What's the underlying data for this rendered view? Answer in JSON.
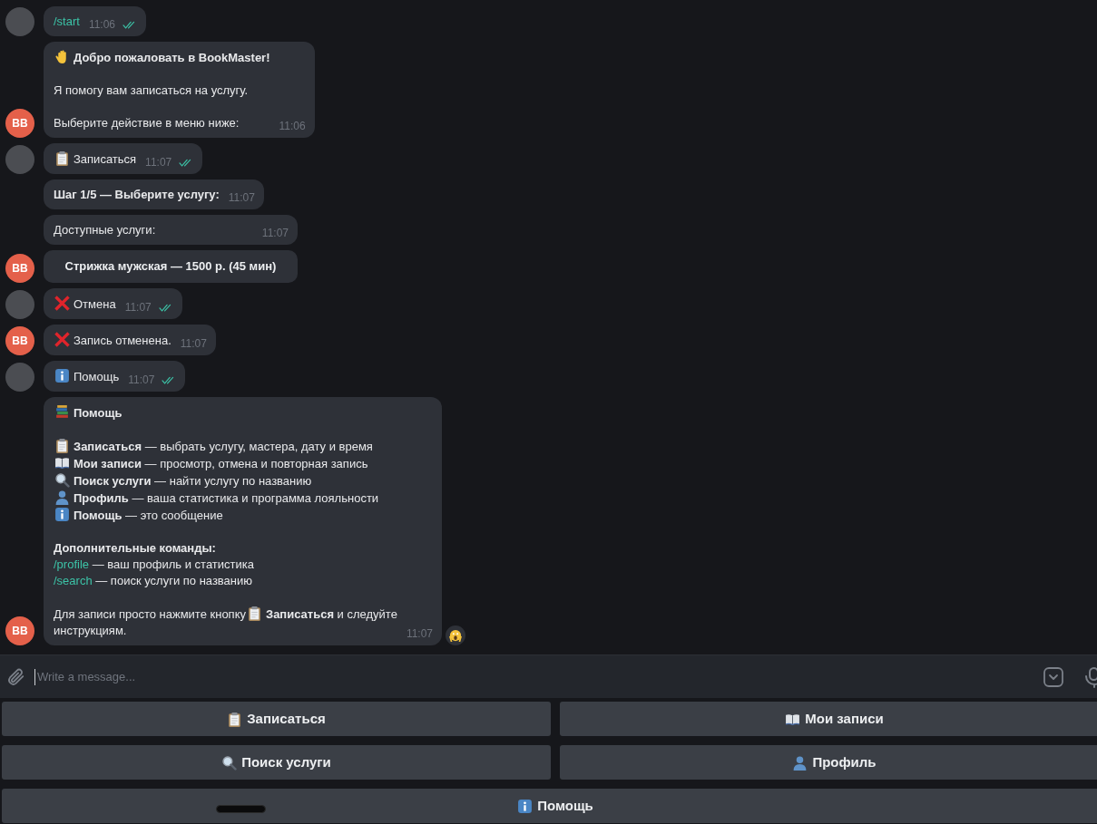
{
  "messages": [
    {
      "kind": "message",
      "avatar": {
        "kind": "photo"
      },
      "paragraphs": [
        [
          [
            {
              "kind": "command",
              "text": "/start"
            }
          ]
        ]
      ],
      "time": "11:06",
      "read": true
    },
    {
      "kind": "message",
      "avatar": {
        "kind": "initials",
        "text": "BB"
      },
      "paragraphs": [
        [
          [
            {
              "kind": "wave"
            },
            {
              "kind": "text",
              "text": "Добро пожаловать в BookMaster!",
              "bold": true
            }
          ]
        ],
        [
          [
            {
              "kind": "text",
              "text": "Я помогу вам записаться на услугу."
            }
          ]
        ],
        [
          [
            {
              "kind": "text",
              "text": "Выберите действие в меню ниже:"
            }
          ]
        ]
      ],
      "time": "11:06"
    },
    {
      "kind": "message",
      "avatar": {
        "kind": "photo"
      },
      "paragraphs": [
        [
          [
            {
              "kind": "clipboard"
            },
            {
              "kind": "text",
              "text": "Записаться"
            }
          ]
        ]
      ],
      "time": "11:07",
      "read": true
    },
    {
      "kind": "message",
      "paragraphs": [
        [
          [
            {
              "kind": "text",
              "text": "Шаг 1/5 — Выберите услугу:",
              "bold": true
            }
          ]
        ]
      ],
      "time": "11:07"
    },
    {
      "kind": "message",
      "paragraphs": [
        [
          [
            {
              "kind": "text",
              "text": "Доступные услуги:"
            }
          ]
        ]
      ],
      "time": "11:07",
      "wide": true
    },
    {
      "kind": "inline_button",
      "avatar": {
        "kind": "initials",
        "text": "BB"
      },
      "label": "Стрижка мужская — 1500 р. (45 мин)"
    },
    {
      "kind": "message",
      "avatar": {
        "kind": "photo"
      },
      "paragraphs": [
        [
          [
            {
              "kind": "cross"
            },
            {
              "kind": "text",
              "text": "Отмена"
            }
          ]
        ]
      ],
      "time": "11:07",
      "read": true
    },
    {
      "kind": "message",
      "avatar": {
        "kind": "initials",
        "text": "BB"
      },
      "paragraphs": [
        [
          [
            {
              "kind": "cross"
            },
            {
              "kind": "text",
              "text": "Запись отменена."
            }
          ]
        ]
      ],
      "time": "11:07"
    },
    {
      "kind": "message",
      "avatar": {
        "kind": "photo"
      },
      "paragraphs": [
        [
          [
            {
              "kind": "info"
            },
            {
              "kind": "text",
              "text": "Помощь"
            }
          ]
        ]
      ],
      "time": "11:07",
      "read": true
    },
    {
      "kind": "message",
      "avatar": {
        "kind": "initials",
        "text": "BB"
      },
      "reaction": true,
      "paragraphs": [
        [
          [
            {
              "kind": "books"
            },
            {
              "kind": "text",
              "text": "Помощь",
              "bold": true
            }
          ]
        ],
        [
          [
            {
              "kind": "clipboard"
            },
            {
              "kind": "text",
              "text": "**Записаться** — выбрать услугу, мастера, дату и время"
            }
          ],
          [
            {
              "kind": "book"
            },
            {
              "kind": "text",
              "text": "**Мои записи** — просмотр, отмена и повторная запись"
            }
          ],
          [
            {
              "kind": "magnifier"
            },
            {
              "kind": "text",
              "text": "**Поиск услуги** — найти услугу по названию"
            }
          ],
          [
            {
              "kind": "person"
            },
            {
              "kind": "text",
              "text": "**Профиль** — ваша статистика и программа лояльности"
            }
          ],
          [
            {
              "kind": "info"
            },
            {
              "kind": "text",
              "text": "**Помощь** — это сообщение"
            }
          ]
        ],
        [
          [
            {
              "kind": "text",
              "text": "Дополнительные команды:",
              "bold": true
            }
          ],
          [
            {
              "kind": "command",
              "text": "/profile"
            },
            {
              "kind": "text",
              "text": " — ваш профиль и статистика"
            }
          ],
          [
            {
              "kind": "command",
              "text": "/search"
            },
            {
              "kind": "text",
              "text": " — поиск услуги по названию"
            }
          ]
        ],
        [
          [
            {
              "kind": "text",
              "text": "Для записи просто нажмите кнопку"
            },
            {
              "kind": "clipboard"
            },
            {
              "kind": "text",
              "text": "**Записаться** и следуйте"
            }
          ],
          [
            {
              "kind": "text",
              "text": "инструкциям."
            }
          ]
        ]
      ],
      "time": "11:07"
    }
  ],
  "composer": {
    "placeholder": "Write a message..."
  },
  "keyboard": [
    [
      {
        "kind": "clipboard",
        "label": "Записаться"
      },
      {
        "kind": "book",
        "label": "Мои записи"
      }
    ],
    [
      {
        "kind": "magnifier",
        "label": "Поиск услуги"
      },
      {
        "kind": "person",
        "label": "Профиль"
      }
    ],
    [
      {
        "kind": "info",
        "label": "Помощь"
      }
    ]
  ]
}
